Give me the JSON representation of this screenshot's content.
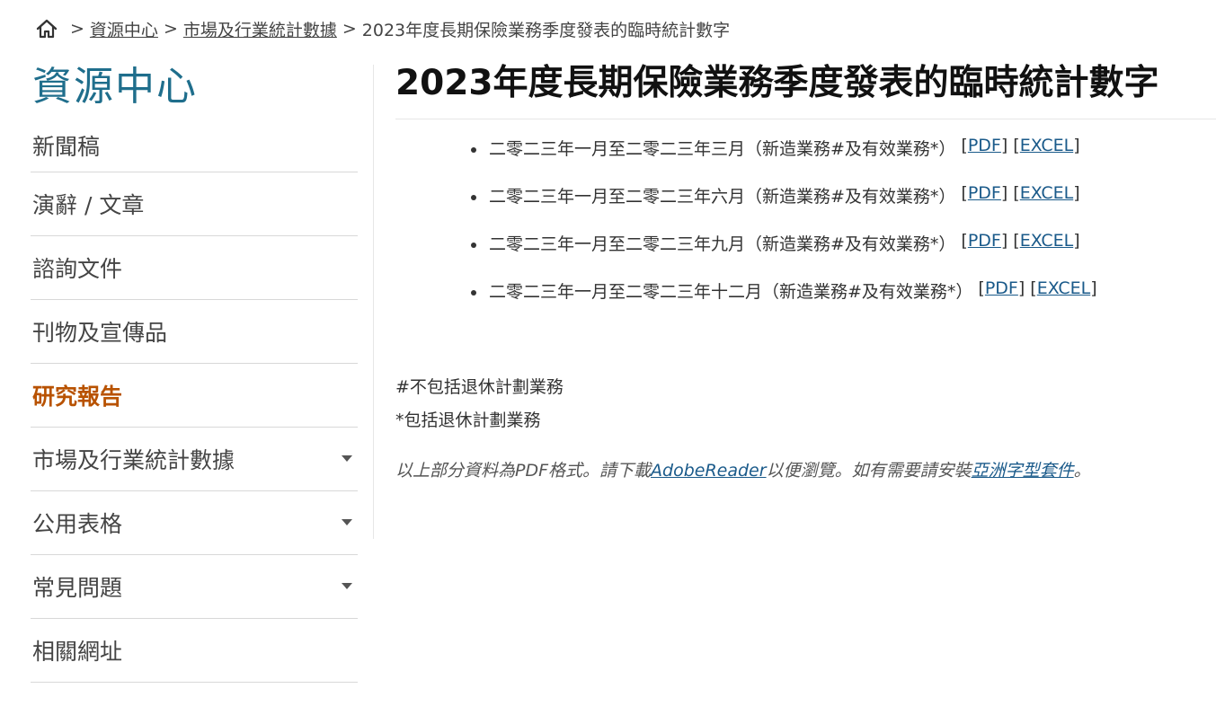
{
  "breadcrumb": {
    "home_icon": "home-icon",
    "separator": ">",
    "items": [
      "資源中心",
      "市場及行業統計數據"
    ],
    "current": "2023年度長期保險業務季度發表的臨時統計數字"
  },
  "sidebar": {
    "title": "資源中心",
    "items": [
      {
        "label": "新聞稿"
      },
      {
        "label": "演辭 / 文章"
      },
      {
        "label": "諮詢文件"
      },
      {
        "label": "刊物及宣傳品"
      },
      {
        "label": "研究報告",
        "active": true
      },
      {
        "label": "市場及行業統計數據",
        "expandable": true
      },
      {
        "label": "公用表格",
        "expandable": true
      },
      {
        "label": "常見問題",
        "expandable": true
      },
      {
        "label": "相關網址"
      }
    ]
  },
  "main": {
    "title": "2023年度長期保險業務季度發表的臨時統計數字",
    "documents": [
      {
        "text": "二零二三年一月至二零二三年三月（新造業務#及有效業務*）",
        "pdf": "PDF",
        "excel": "EXCEL"
      },
      {
        "text": "二零二三年一月至二零二三年六月（新造業務#及有效業務*）",
        "pdf": "PDF",
        "excel": "EXCEL"
      },
      {
        "text": "二零二三年一月至二零二三年九月（新造業務#及有效業務*）",
        "pdf": "PDF",
        "excel": "EXCEL"
      },
      {
        "text": "二零二三年一月至二零二三年十二月（新造業務#及有效業務*）",
        "pdf": "PDF",
        "excel": "EXCEL"
      }
    ],
    "notes": [
      "#不包括退休計劃業務",
      "*包括退休計劃業務"
    ],
    "info": {
      "prefix": "以上部分資料為PDF格式。請下載",
      "adobe_link": "AdobeReader",
      "middle": "以便瀏覽。如有需要請安裝",
      "font_link": "亞洲字型套件",
      "suffix": "。"
    }
  },
  "colors": {
    "accent": "#1f6e8c",
    "active": "#b85200",
    "link": "#1a5a8a"
  }
}
